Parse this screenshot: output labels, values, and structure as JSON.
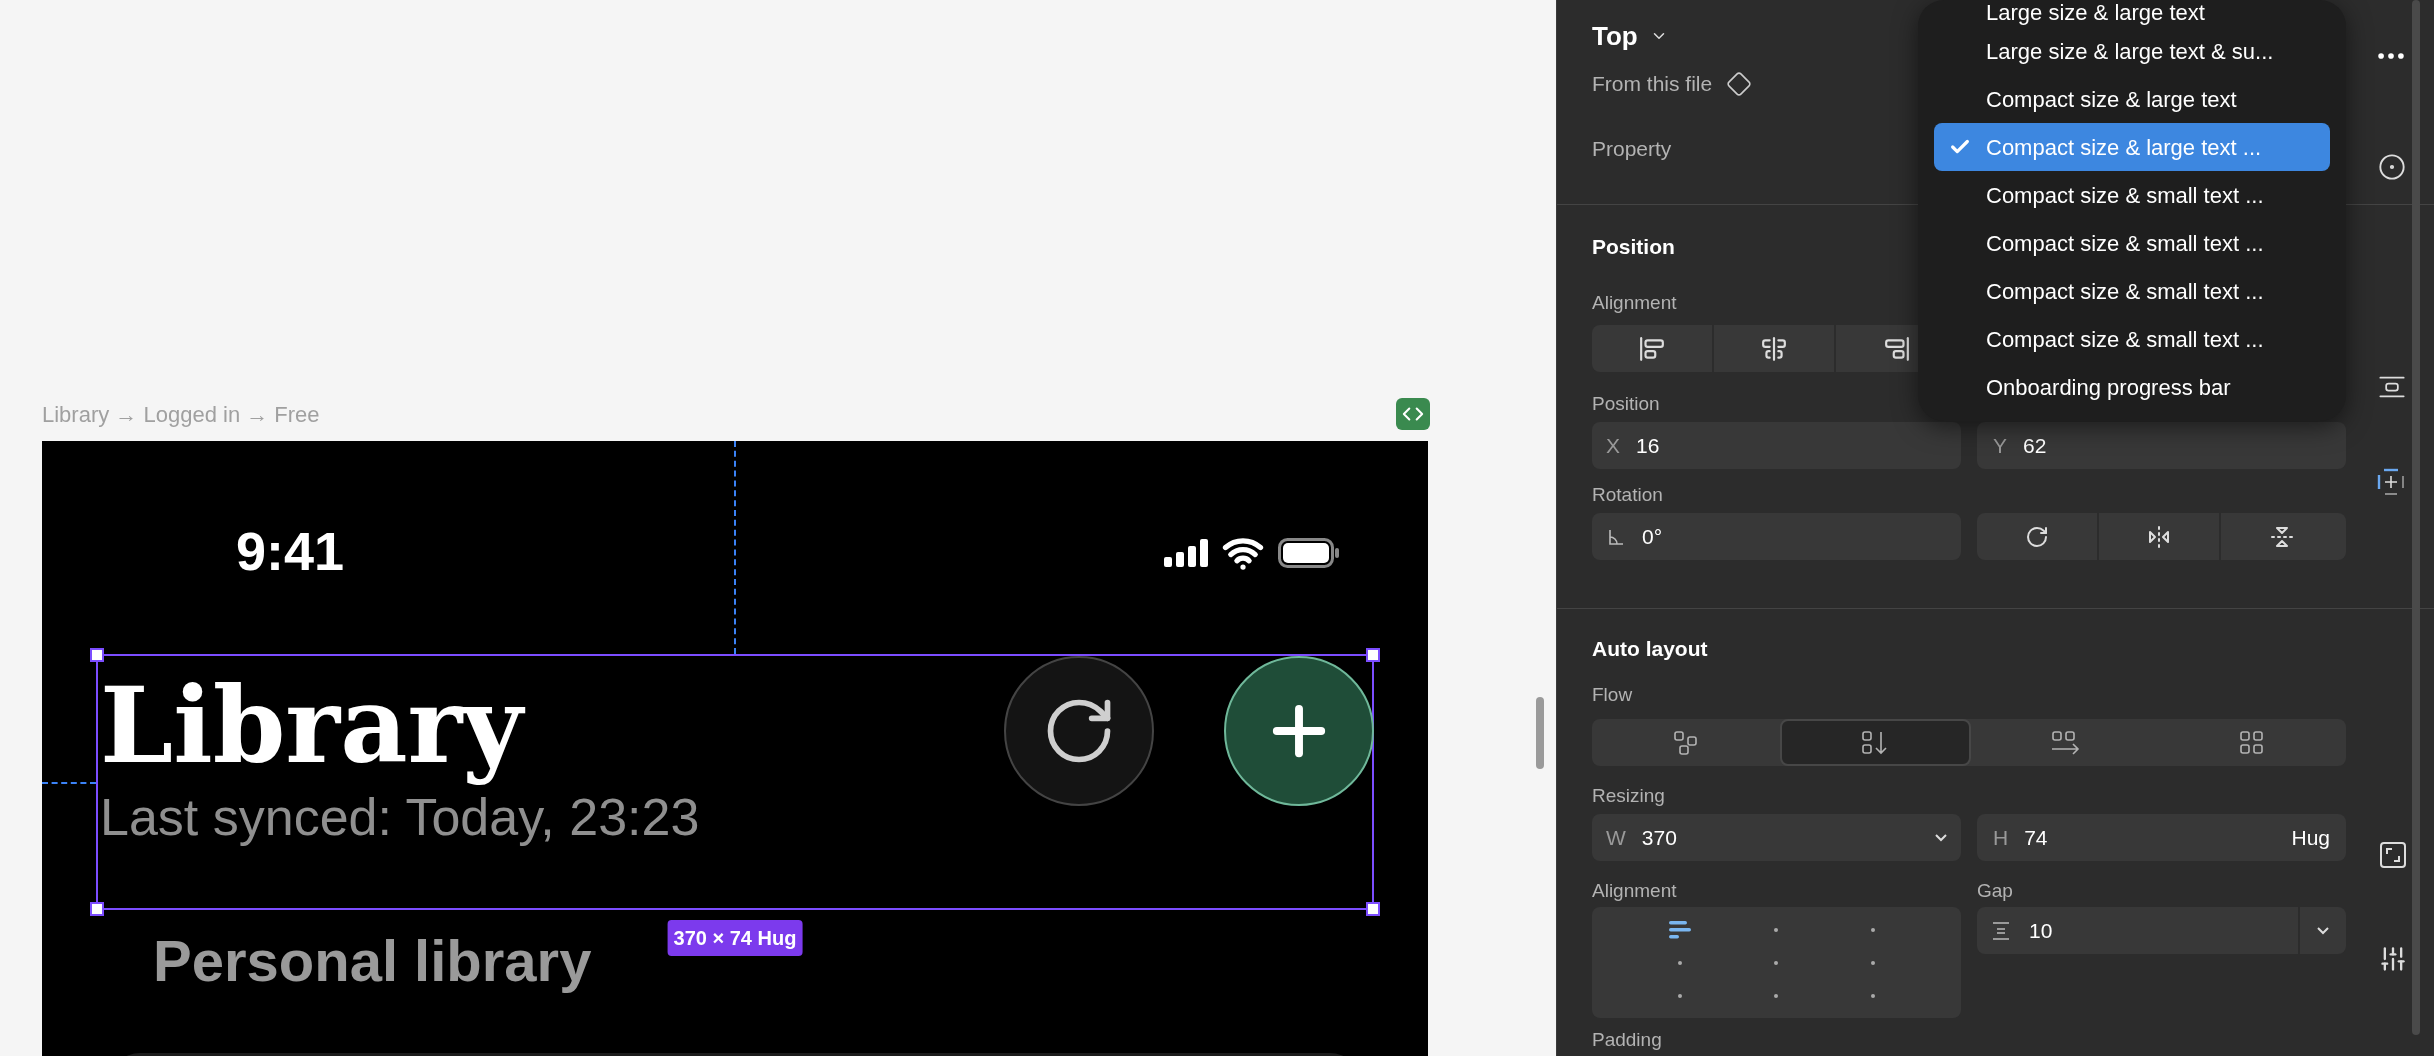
{
  "canvas": {
    "breadcrumb": "Library → Logged in → Free",
    "phone": {
      "time": "9:41",
      "title": "Library",
      "subtitle": "Last synced: Today, 23:23",
      "section": "Personal library"
    },
    "selection_label": "370 × 74 Hug"
  },
  "panel": {
    "instance": "Top",
    "source": "From this file",
    "property_label": "Property",
    "position": {
      "heading": "Position",
      "alignment_label": "Alignment",
      "position_label": "Position",
      "x": {
        "prefix": "X",
        "value": "16"
      },
      "y": {
        "prefix": "Y",
        "value": "62"
      },
      "rotation_label": "Rotation",
      "rotation": "0°"
    },
    "auto_layout": {
      "heading": "Auto layout",
      "flow_label": "Flow",
      "flow": [
        {
          "kind": "free",
          "selected": false
        },
        {
          "kind": "vertical",
          "selected": true
        },
        {
          "kind": "horizontal",
          "selected": false
        },
        {
          "kind": "grid",
          "selected": false
        }
      ],
      "resizing_label": "Resizing",
      "w": {
        "prefix": "W",
        "value": "370"
      },
      "h": {
        "prefix": "H",
        "value": "74",
        "mode": "Hug"
      },
      "alignment_label": "Alignment",
      "alignment_grid": [
        {
          "selected": true
        },
        {
          "selected": false
        },
        {
          "selected": false
        },
        {
          "selected": false
        },
        {
          "selected": false
        },
        {
          "selected": false
        },
        {
          "selected": false
        },
        {
          "selected": false
        },
        {
          "selected": false
        }
      ],
      "gap_label": "Gap",
      "gap": "10",
      "padding_label": "Padding"
    }
  },
  "dropdown": {
    "items": [
      {
        "label": "Large size & large text",
        "selected": false
      },
      {
        "label": "Large size & large text & su...",
        "selected": false
      },
      {
        "label": "Compact size & large text",
        "selected": false
      },
      {
        "label": "Compact size & large text ...",
        "selected": true
      },
      {
        "label": "Compact size & small text ...",
        "selected": false
      },
      {
        "label": "Compact size & small text ...",
        "selected": false
      },
      {
        "label": "Compact size & small text ...",
        "selected": false
      },
      {
        "label": "Compact size & small text ...",
        "selected": false
      },
      {
        "label": "Onboarding progress bar",
        "selected": false
      }
    ]
  }
}
